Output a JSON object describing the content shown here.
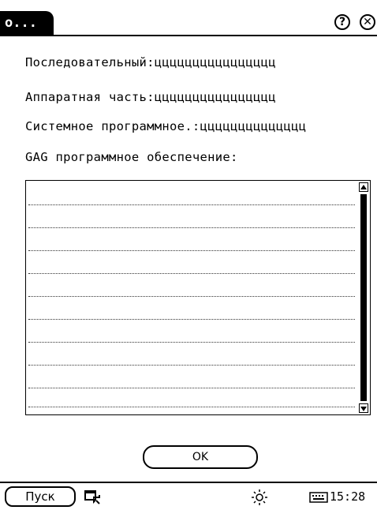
{
  "window": {
    "title": "о...",
    "help_icon": "question-circle-icon",
    "close_icon": "close-x-icon"
  },
  "info": {
    "serial": "Последовательный:цццццццццццццццц",
    "hardware": "Аппаратная часть:цццццццццццццццц",
    "system_software": "Системное программное.:цццццццццццццц",
    "gag_software": "GAG программное обеспечение:"
  },
  "list": {
    "rows": [
      "",
      "",
      "",
      "",
      "",
      "",
      "",
      "",
      "",
      ""
    ]
  },
  "dialog": {
    "ok_label": "OK"
  },
  "taskbar": {
    "start_label": "Пуск",
    "switch_icon": "window-switch-icon",
    "brightness_icon": "brightness-icon",
    "keyboard_icon": "keyboard-icon",
    "clock": "15:28"
  }
}
